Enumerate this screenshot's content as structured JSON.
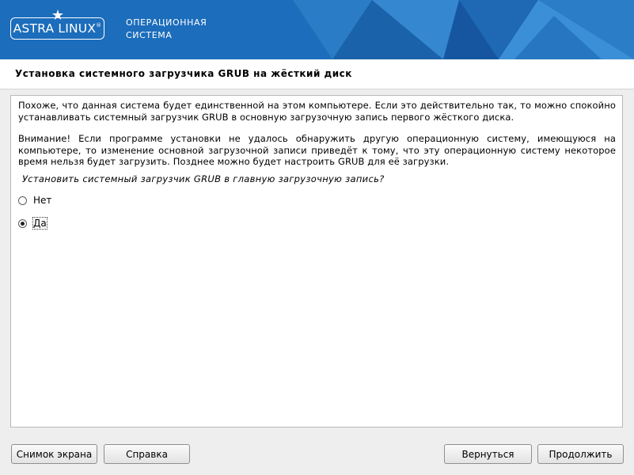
{
  "header": {
    "logo_text": "ASTRA LINUX",
    "logo_reg": "®",
    "os_line1": "ОПЕРАЦИОННАЯ",
    "os_line2": "СИСТЕМА"
  },
  "page_title": "Установка системного загрузчика GRUB на жёсткий диск",
  "content": {
    "paragraph1": "Похоже, что данная система будет единственной на этом компьютере. Если это действительно так, то можно спокойно устанавливать системный загрузчик GRUB в основную загрузочную запись первого жёсткого диска.",
    "paragraph2": "Внимание! Если программе установки не удалось обнаружить другую операционную систему, имеющуюся на компьютере, то изменение основной загрузочной записи приведёт к тому, что эту операционную систему некоторое время нельзя будет загрузить. Позднее можно будет настроить GRUB для её загрузки.",
    "question": "Установить системный загрузчик GRUB в главную загрузочную запись?",
    "options": [
      {
        "label": "Нет",
        "selected": false
      },
      {
        "label": "Да",
        "selected": true
      }
    ]
  },
  "buttons": {
    "screenshot": "Снимок экрана",
    "help": "Справка",
    "back": "Вернуться",
    "continue": "Продолжить"
  },
  "colors": {
    "banner": "#1c6dbb",
    "background": "#eeeeee"
  }
}
